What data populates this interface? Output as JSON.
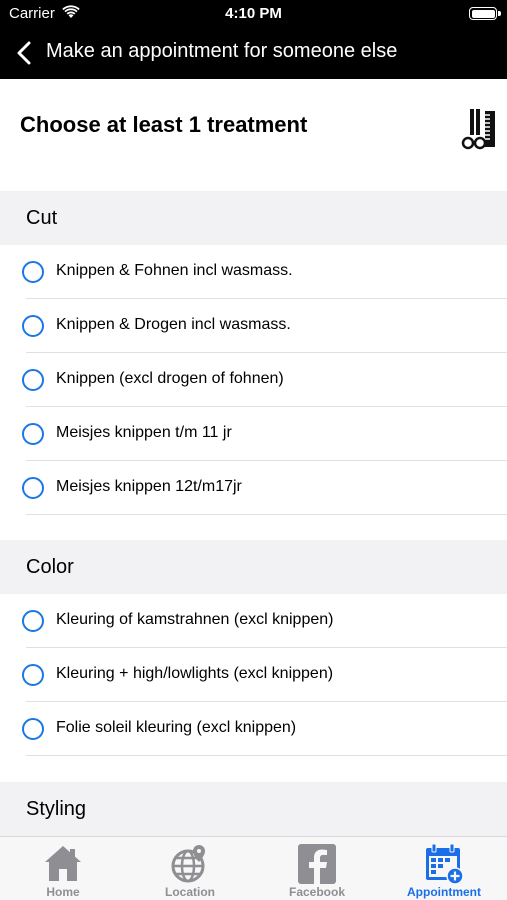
{
  "status": {
    "carrier": "Carrier",
    "time": "4:10 PM"
  },
  "nav": {
    "title": "Make an appointment for someone else"
  },
  "header": {
    "title": "Choose at least 1 treatment",
    "icon": "scissors-comb-icon"
  },
  "sections": [
    {
      "label": "Cut",
      "items": [
        "Knippen & Fohnen incl wasmass.",
        "Knippen & Drogen incl wasmass.",
        "Knippen (excl drogen of fohnen)",
        "Meisjes knippen  t/m 11 jr",
        "Meisjes knippen 12t/m17jr"
      ]
    },
    {
      "label": "Color",
      "items": [
        "Kleuring of kamstrahnen (excl knippen)",
        "Kleuring + high/lowlights (excl knippen)",
        "Folie soleil kleuring (excl knippen)"
      ]
    },
    {
      "label": "Styling",
      "items": []
    }
  ],
  "tabs": [
    {
      "label": "Home",
      "icon": "home-icon",
      "active": false
    },
    {
      "label": "Location",
      "icon": "globe-pin-icon",
      "active": false
    },
    {
      "label": "Facebook",
      "icon": "facebook-icon",
      "active": false
    },
    {
      "label": "Appointment",
      "icon": "calendar-add-icon",
      "active": true
    }
  ],
  "colors": {
    "accent": "#1a78e6",
    "tab_active": "#1a6fe8",
    "tab_inactive": "#8e8e93",
    "section_bg": "#f2f2f4"
  }
}
